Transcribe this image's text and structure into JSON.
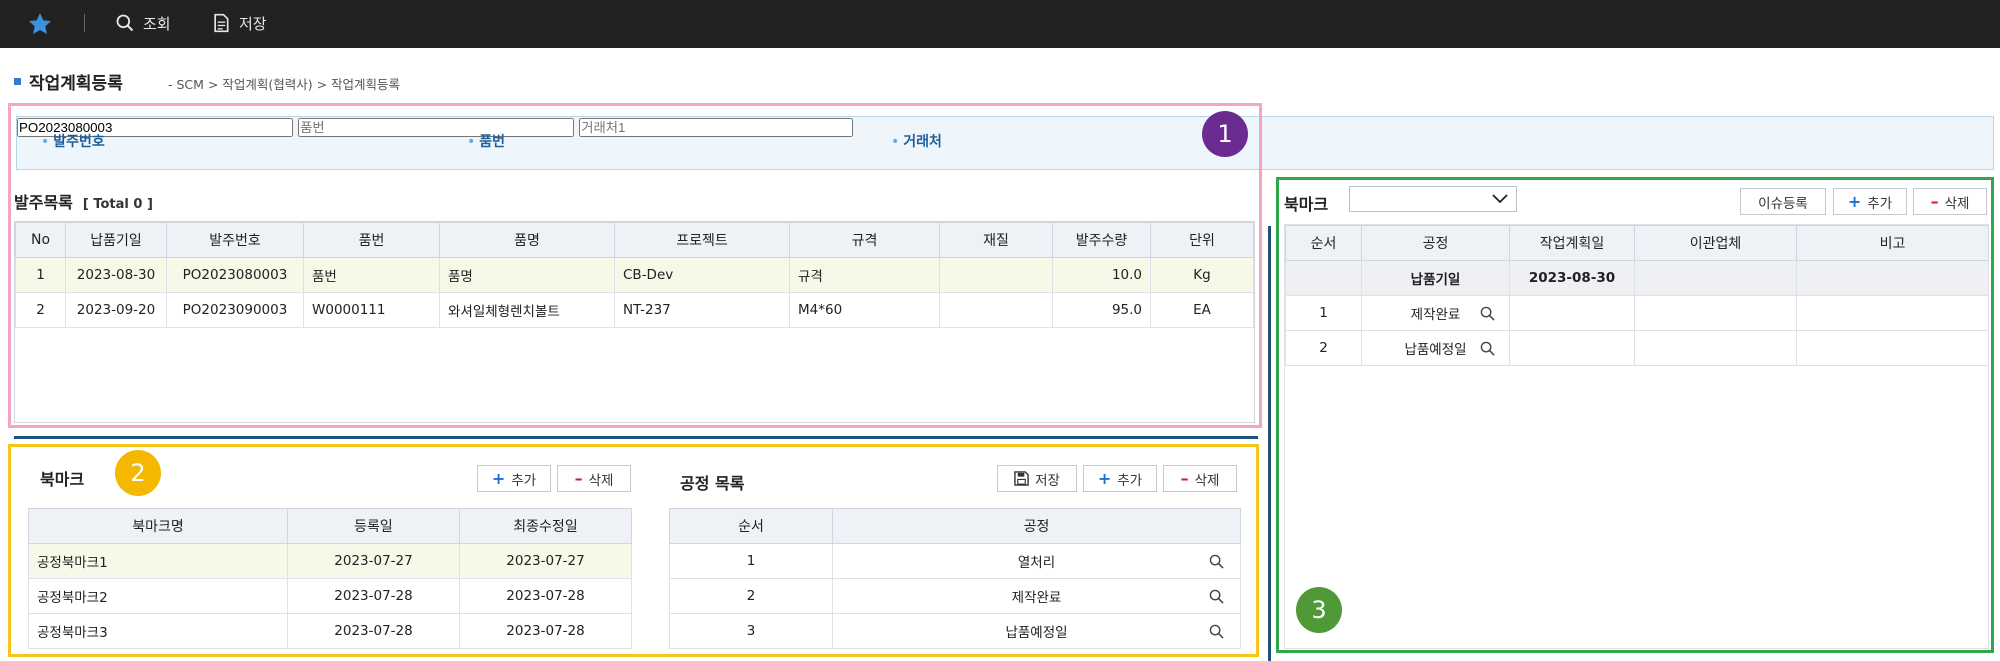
{
  "toolbar": {
    "search_label": "조회",
    "save_label": "저장"
  },
  "header": {
    "title": "작업계획등록",
    "breadcrumb": "- SCM > 작업계획(협력사) > 작업계획등록"
  },
  "search": {
    "order_no_label": "발주번호",
    "order_no_value": "PO2023080003",
    "item_no_label": "품번",
    "item_no_placeholder": "품번",
    "vendor_label": "거래처",
    "vendor_placeholder": "거래처1"
  },
  "order_list": {
    "title": "발주목록",
    "total": "[ Total 0 ]",
    "columns": [
      "No",
      "납품기일",
      "발주번호",
      "품번",
      "품명",
      "프로젝트",
      "규격",
      "재질",
      "발주수량",
      "단위"
    ],
    "rows": [
      [
        "1",
        "2023-08-30",
        "PO2023080003",
        "품번",
        "품명",
        "CB-Dev",
        "규격",
        "",
        "10.0",
        "Kg"
      ],
      [
        "2",
        "2023-09-20",
        "PO2023090003",
        "W0000111",
        "와셔일체형렌치볼트",
        "NT-237",
        "M4*60",
        "",
        "95.0",
        "EA"
      ]
    ]
  },
  "bookmark_panel": {
    "title": "북마크",
    "add_label": "추가",
    "delete_label": "삭제",
    "columns": [
      "북마크명",
      "등록일",
      "최종수정일"
    ],
    "rows": [
      [
        "공정북마크1",
        "2023-07-27",
        "2023-07-27"
      ],
      [
        "공정북마크2",
        "2023-07-28",
        "2023-07-28"
      ],
      [
        "공정북마크3",
        "2023-07-28",
        "2023-07-28"
      ]
    ]
  },
  "process_panel": {
    "title": "공정 목록",
    "save_label": "저장",
    "add_label": "추가",
    "delete_label": "삭제",
    "columns": [
      "순서",
      "공정"
    ],
    "rows": [
      [
        "1",
        "열처리"
      ],
      [
        "2",
        "제작완료"
      ],
      [
        "3",
        "납품예정일"
      ]
    ]
  },
  "work_plan": {
    "bookmark_label": "북마크",
    "issue_label": "이슈등록",
    "add_label": "추가",
    "delete_label": "삭제",
    "columns": [
      "순서",
      "공정",
      "작업계획일",
      "이관업체",
      "비고"
    ],
    "group_row": [
      "",
      "납품기일",
      "2023-08-30",
      "",
      ""
    ],
    "rows": [
      [
        "1",
        "제작완료",
        "",
        "",
        ""
      ],
      [
        "2",
        "납품예정일",
        "",
        "",
        ""
      ]
    ]
  },
  "annotations": {
    "badge1": "1",
    "badge2": "2",
    "badge3": "3",
    "color1": "#6a2c91",
    "color2": "#f5b800",
    "color3": "#4f9a37",
    "box1": "#f3a6c4",
    "box2": "#f5c518",
    "box3": "#2ea84a"
  },
  "icons": {
    "star": "star-icon",
    "search": "search-icon",
    "document": "document-icon",
    "magnifier": "magnifier-icon",
    "floppy": "floppy-icon",
    "chevron": "chevron-down-icon"
  }
}
